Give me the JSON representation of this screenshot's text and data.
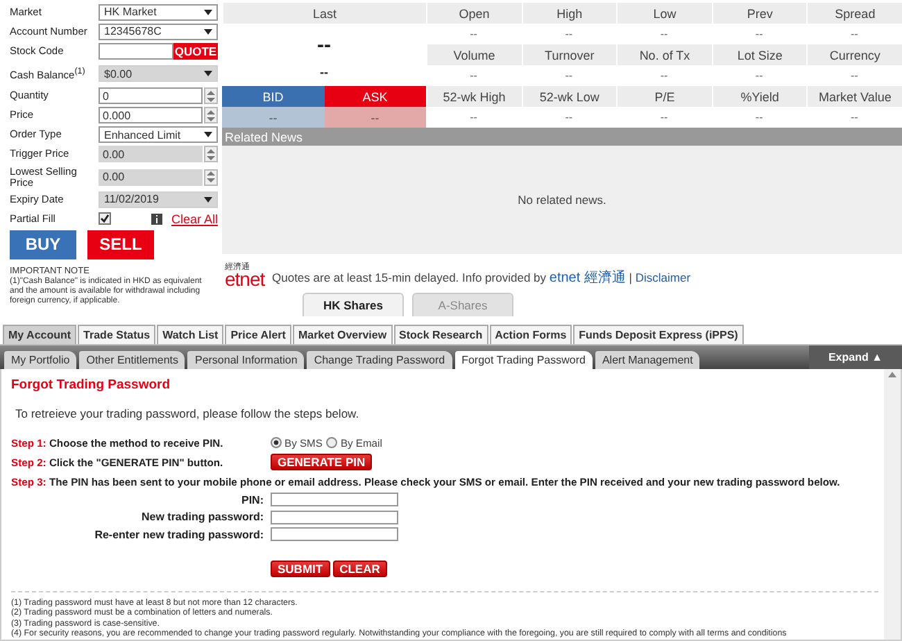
{
  "order_form": {
    "fields": [
      {
        "label": "Market",
        "kind": "select",
        "value": "HK Market",
        "disabled": false
      },
      {
        "label": "Account Number",
        "kind": "select",
        "value": "12345678C",
        "disabled": false
      },
      {
        "label": "Stock Code",
        "kind": "code",
        "button": "QUOTE"
      },
      {
        "label": "Cash Balance$^{(1)}$",
        "kind": "select",
        "value": "$0.00",
        "disabled": true
      },
      {
        "label": "Quantity",
        "kind": "spinner",
        "value": "0",
        "disabled": false
      },
      {
        "label": "Price",
        "kind": "spinner",
        "value": "0.000",
        "disabled": false
      },
      {
        "label": "Order Type",
        "kind": "select",
        "value": "Enhanced Limit",
        "disabled": false
      },
      {
        "label": "Trigger Price",
        "kind": "spinner",
        "value": "0.00",
        "disabled": true
      },
      {
        "label": "Lowest Selling Price",
        "kind": "spinner",
        "value": "0.00",
        "disabled": true
      },
      {
        "label": "Expiry Date",
        "kind": "select",
        "value": "11/02/2019",
        "disabled": true
      },
      {
        "label": "Partial Fill",
        "kind": "checkbox",
        "checked": true,
        "link": "Clear All"
      }
    ],
    "buy_button": "BUY",
    "sell_button": "SELL",
    "note_title": "IMPORTANT NOTE",
    "note": "(1)\"Cash Balance\" is indicated in HKD as equivalent and the amount is available for withdrawal including foreign currency, if applicable."
  },
  "quote": {
    "last_label": "Last",
    "last_value": "--",
    "last_change": "--",
    "bid_label": "BID",
    "bid_value": "--",
    "ask_label": "ASK",
    "ask_value": "--",
    "stats": [
      {
        "label": "Open",
        "value": "--"
      },
      {
        "label": "High",
        "value": "--"
      },
      {
        "label": "Low",
        "value": "--"
      },
      {
        "label": "Prev",
        "value": "--"
      },
      {
        "label": "Spread",
        "value": "--"
      },
      {
        "label": "Volume",
        "value": "--"
      },
      {
        "label": "Turnover",
        "value": "--"
      },
      {
        "label": "No. of Tx",
        "value": "--"
      },
      {
        "label": "Lot Size",
        "value": "--"
      },
      {
        "label": "Currency",
        "value": "--"
      },
      {
        "label": "52-wk High",
        "value": "--"
      },
      {
        "label": "52-wk Low",
        "value": "--"
      },
      {
        "label": "P/E",
        "value": "--"
      },
      {
        "label": "%Yield",
        "value": "--"
      },
      {
        "label": "Market Value",
        "value": "--"
      }
    ]
  },
  "related_news": {
    "title": "Related News",
    "empty": "No related news."
  },
  "source": {
    "logo_small": "經濟通",
    "logo": "etnet",
    "text": "Quotes are at least 15-min delayed.  Info provided by",
    "provider_link": "etnet 經濟通",
    "separator": "|",
    "disclaimer_link": "Disclaimer"
  },
  "market_tabs": [
    {
      "label": "HK Shares",
      "selected": true
    },
    {
      "label": "A-Shares",
      "selected": false
    }
  ],
  "main_tabs": [
    {
      "label": "My Account",
      "selected": true
    },
    {
      "label": "Trade Status",
      "selected": false
    },
    {
      "label": "Watch List",
      "selected": false
    },
    {
      "label": "Price Alert",
      "selected": false
    },
    {
      "label": "Market Overview",
      "selected": false
    },
    {
      "label": "Stock Research",
      "selected": false
    },
    {
      "label": "Action Forms",
      "selected": false
    },
    {
      "label": "Funds Deposit Express (iPPS)",
      "selected": false
    }
  ],
  "sub_tabs": [
    {
      "label": "My Portfolio",
      "selected": false
    },
    {
      "label": "Other Entitlements",
      "selected": false
    },
    {
      "label": "Personal Information",
      "selected": false
    },
    {
      "label": "Change Trading Password",
      "selected": false
    },
    {
      "label": "Forgot Trading Password",
      "selected": true
    },
    {
      "label": "Alert Management",
      "selected": false
    }
  ],
  "expand_button": "Expand ▲",
  "forgot_password": {
    "title": "Forgot Trading Password",
    "intro": "To retreieve your trading password, please follow the steps below.",
    "step1": {
      "label": "Step 1:",
      "text": "Choose the method to receive PIN.",
      "options": [
        {
          "label": "By SMS",
          "selected": true
        },
        {
          "label": "By Email",
          "selected": false
        }
      ]
    },
    "step2": {
      "label": "Step 2:",
      "text": "Click the \"GENERATE PIN\" button.",
      "button": "GENERATE PIN"
    },
    "step3": {
      "label": "Step 3:",
      "text": "The PIN has been sent to your mobile phone or email address. Please check your SMS or email. Enter the PIN received and your new trading password below."
    },
    "inputs": [
      {
        "label": "PIN:"
      },
      {
        "label": "New trading password:"
      },
      {
        "label": "Re-enter new trading password:"
      }
    ],
    "submit_button": "SUBMIT",
    "clear_button": "CLEAR",
    "notes": [
      "(1) Trading password must have at least 8 but not more than 12 characters.",
      "(2) Trading password must be a combination of letters and numerals.",
      "(3) Trading password is case-sensitive.",
      "(4) For security reasons, you are recommended to change your trading password regularly. Notwithstanding your compliance with the foregoing, you are still required to comply with all terms and conditions"
    ]
  }
}
